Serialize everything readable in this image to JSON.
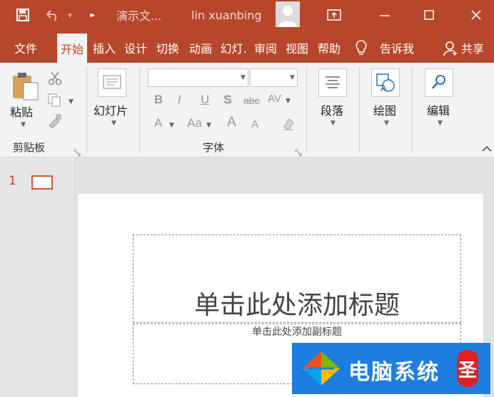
{
  "titlebar": {
    "doc_title": "演示文...",
    "user_name": "lin xuanbing",
    "overflow_glyph": "▸▸",
    "undo_caret": "▾"
  },
  "tabs": [
    {
      "label": "文件"
    },
    {
      "label": "开始"
    },
    {
      "label": "插入"
    },
    {
      "label": "设计"
    },
    {
      "label": "切换"
    },
    {
      "label": "动画"
    },
    {
      "label": "幻灯."
    },
    {
      "label": "审阅"
    },
    {
      "label": "视图"
    },
    {
      "label": "帮助"
    }
  ],
  "tell_me": "告诉我",
  "share": "共享",
  "ribbon": {
    "paste": "粘贴",
    "clipboard_group": "剪贴板",
    "slides": "幻灯片",
    "font_group": "字体",
    "font_buttons": {
      "bold": "B",
      "italic": "I",
      "underline": "U",
      "shadow": "S",
      "strike": "abc",
      "spacing": "AV",
      "fontcolor": "A",
      "changecase": "Aa",
      "grow": "A",
      "shrink": "A"
    },
    "paragraph": "段落",
    "drawing": "绘图",
    "editing": "编辑"
  },
  "thumbnail_number": "1",
  "slide": {
    "title_placeholder": "单击此处添加标题",
    "subtitle_placeholder": "单击此处添加副标题"
  },
  "watermark": {
    "text": "电脑系统",
    "badge": "圣"
  },
  "colors": {
    "accent": "#b7472a",
    "ribbon_bg": "#f3f3f3",
    "watermark_blue": "#1e7ee0"
  }
}
